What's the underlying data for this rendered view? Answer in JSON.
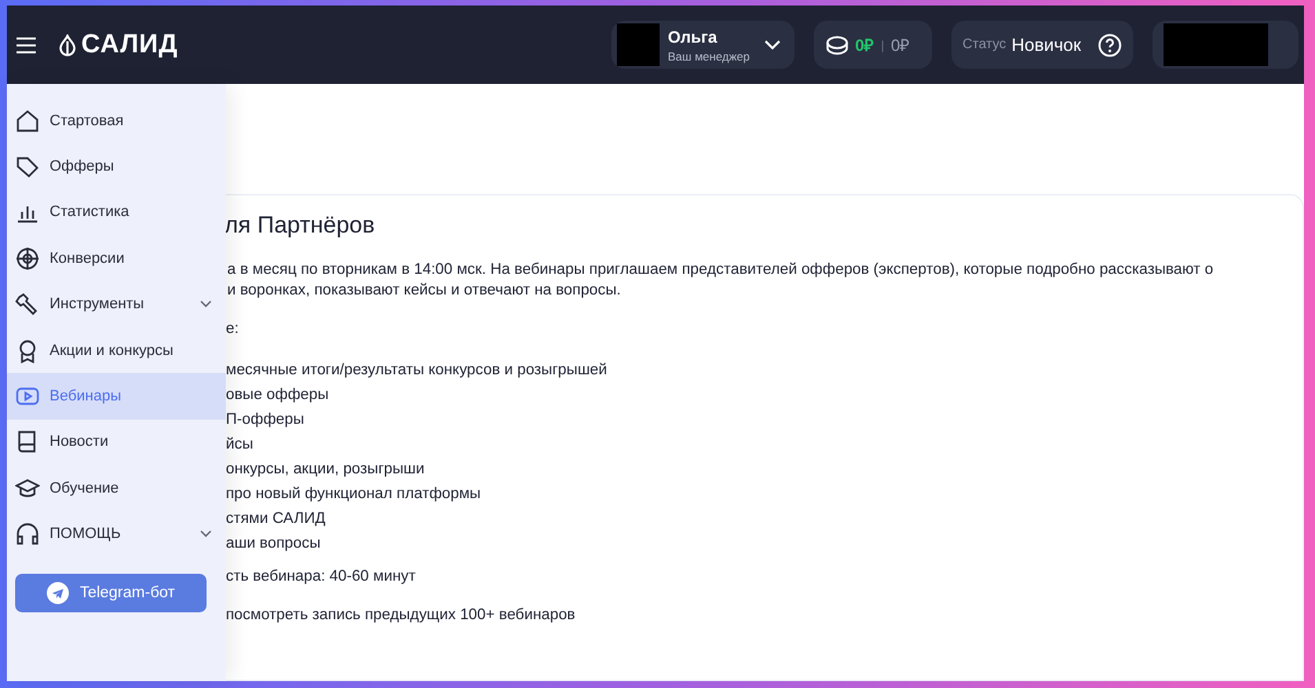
{
  "header": {
    "logo": "САЛИД",
    "manager": {
      "name": "Ольга",
      "role": "Ваш менеджер"
    },
    "balance": {
      "available": "0₽",
      "separator": "|",
      "hold": "0₽"
    },
    "status": {
      "label": "Статус",
      "value": "Новичок"
    }
  },
  "sidebar": {
    "items": [
      {
        "label": "Стартовая",
        "selected": false,
        "expandable": false
      },
      {
        "label": "Офферы",
        "selected": false,
        "expandable": false
      },
      {
        "label": "Статистика",
        "selected": false,
        "expandable": false
      },
      {
        "label": "Конверсии",
        "selected": false,
        "expandable": false
      },
      {
        "label": "Инструменты",
        "selected": false,
        "expandable": true
      },
      {
        "label": "Акции и конкурсы",
        "selected": false,
        "expandable": false
      },
      {
        "label": "Вебинары",
        "selected": true,
        "expandable": false
      },
      {
        "label": "Новости",
        "selected": false,
        "expandable": false
      },
      {
        "label": "Обучение",
        "selected": false,
        "expandable": false
      },
      {
        "label": "ПОМОЩЬ",
        "selected": false,
        "expandable": true
      }
    ],
    "telegram_button": "Telegram-бот"
  },
  "content": {
    "title": "ля Партнёров",
    "paragraph_lines": [
      "а в месяц по вторникам в 14:00 мск. На вебинары приглашаем представителей офферов (экспертов), которые подробно рассказывают о",
      "и воронках, показывают кейсы и отвечают на вопросы."
    ],
    "list_heading": "е:",
    "list": [
      "месячные итоги/результаты конкурсов и розыгрышей",
      "овые офферы",
      "П-офферы",
      "йсы",
      "онкурсы, акции, розыгрыши",
      "про новый функционал платформы",
      "стями САЛИД",
      "аши вопросы"
    ],
    "duration": "сть вебинара: 40-60 минут",
    "archive": "посмотреть запись предыдущих 100+ вебинаров"
  }
}
